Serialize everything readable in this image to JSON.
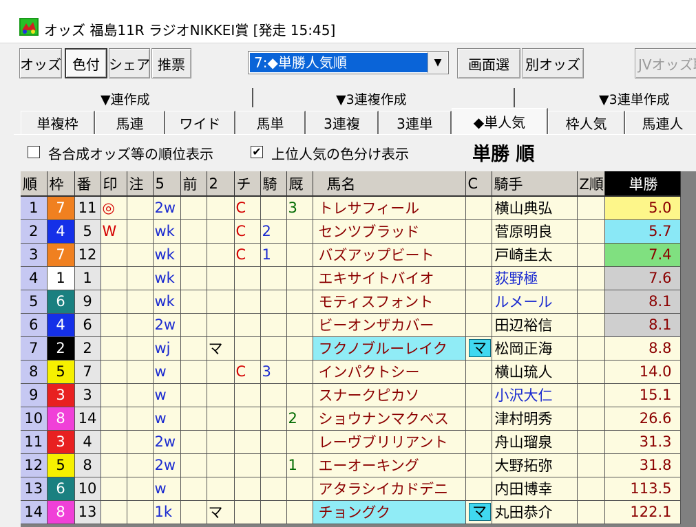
{
  "window": {
    "title": "オッズ 福島11R ラジオNIKKEI賞 [発走 15:45]"
  },
  "toolbar": {
    "buttons": [
      "オッズ",
      "色付",
      "シェア",
      "推票"
    ],
    "combo_value": "7:◆単勝人気順",
    "screen_select": "画面選",
    "other_odds": "別オッズ",
    "jv_odds": "JVオッズ取"
  },
  "groups": [
    "▼連作成",
    "▼3連複作成",
    "▼3連単作成"
  ],
  "tabs": [
    "単複枠",
    "馬連",
    "ワイド",
    "馬単",
    "3連複",
    "3連単",
    "◆単人気",
    "枠人気",
    "馬連人"
  ],
  "options": {
    "rank_display": "各合成オッズ等の順位表示",
    "rank_display_checked": false,
    "color_display": "上位人気の色分け表示",
    "color_display_checked": true,
    "sort_title": "単勝 順"
  },
  "columns": [
    "順",
    "枠",
    "番",
    "印",
    "注",
    "5",
    "前",
    "2",
    "チ",
    "騎",
    "厩",
    "馬名",
    "C",
    "騎手",
    "Z順",
    "単勝"
  ],
  "colors": {
    "waku": {
      "1": [
        "#ffffff",
        "#000000"
      ],
      "2": [
        "#000000",
        "#ffffff"
      ],
      "3": [
        "#e82020",
        "#ffffff"
      ],
      "4": [
        "#1530e8",
        "#ffffff"
      ],
      "5": [
        "#f6f000",
        "#000000"
      ],
      "6": [
        "#1a8080",
        "#ffffff"
      ],
      "7": [
        "#f08020",
        "#ffffff"
      ],
      "8": [
        "#f040d8",
        "#ffffff"
      ]
    },
    "odds_highlight": {
      "1": "#fdf68a",
      "2": "#8ae8f6",
      "3": "#80e080",
      "others_top": "#cfcfcf"
    }
  },
  "rows": [
    {
      "rank": "1",
      "waku": "7",
      "num": "11",
      "mark": "◎",
      "note": "",
      "c5": "2w",
      "mae": "",
      "c2": "",
      "chi": "C",
      "ki": "",
      "kyu": "3",
      "name": "トレサフィール",
      "c": "",
      "jockey": "横山典弘",
      "jblue": false,
      "z": "",
      "odds": "5.0"
    },
    {
      "rank": "2",
      "waku": "4",
      "num": "5",
      "mark": "W",
      "note": "",
      "c5": "wk",
      "mae": "",
      "c2": "",
      "chi": "C",
      "ki": "2",
      "kyu": "",
      "name": "センツブラッド",
      "c": "",
      "jockey": "菅原明良",
      "jblue": false,
      "z": "",
      "odds": "5.7"
    },
    {
      "rank": "3",
      "waku": "7",
      "num": "12",
      "mark": "",
      "note": "",
      "c5": "wk",
      "mae": "",
      "c2": "",
      "chi": "C",
      "ki": "1",
      "kyu": "",
      "name": "バズアップビート",
      "c": "",
      "jockey": "戸崎圭太",
      "jblue": false,
      "z": "",
      "odds": "7.4"
    },
    {
      "rank": "4",
      "waku": "1",
      "num": "1",
      "mark": "",
      "note": "",
      "c5": "wk",
      "mae": "",
      "c2": "",
      "chi": "",
      "ki": "",
      "kyu": "",
      "name": "エキサイトバイオ",
      "c": "",
      "jockey": "荻野極",
      "jblue": true,
      "z": "",
      "odds": "7.6"
    },
    {
      "rank": "5",
      "waku": "6",
      "num": "9",
      "mark": "",
      "note": "",
      "c5": "wk",
      "mae": "",
      "c2": "",
      "chi": "",
      "ki": "",
      "kyu": "",
      "name": "モティスフォント",
      "c": "",
      "jockey": "ルメール",
      "jblue": true,
      "z": "",
      "odds": "8.1"
    },
    {
      "rank": "6",
      "waku": "4",
      "num": "6",
      "mark": "",
      "note": "",
      "c5": "2w",
      "mae": "",
      "c2": "",
      "chi": "",
      "ki": "",
      "kyu": "",
      "name": "ビーオンザカバー",
      "c": "",
      "jockey": "田辺裕信",
      "jblue": false,
      "z": "",
      "odds": "8.1"
    },
    {
      "rank": "7",
      "waku": "2",
      "num": "2",
      "mark": "",
      "note": "",
      "c5": "wj",
      "mae": "",
      "c2": "マ",
      "chi": "",
      "ki": "",
      "kyu": "",
      "name": "フクノブルーレイク",
      "c": "マ",
      "jockey": "松岡正海",
      "jblue": false,
      "z": "",
      "odds": "8.8"
    },
    {
      "rank": "8",
      "waku": "5",
      "num": "7",
      "mark": "",
      "note": "",
      "c5": "w",
      "mae": "",
      "c2": "",
      "chi": "C",
      "ki": "3",
      "kyu": "",
      "name": "インパクトシー",
      "c": "",
      "jockey": "横山琉人",
      "jblue": false,
      "z": "",
      "odds": "14.0"
    },
    {
      "rank": "9",
      "waku": "3",
      "num": "3",
      "mark": "",
      "note": "",
      "c5": "w",
      "mae": "",
      "c2": "",
      "chi": "",
      "ki": "",
      "kyu": "",
      "name": "スナークピカソ",
      "c": "",
      "jockey": "小沢大仁",
      "jblue": true,
      "z": "",
      "odds": "15.1"
    },
    {
      "rank": "10",
      "waku": "8",
      "num": "14",
      "mark": "",
      "note": "",
      "c5": "w",
      "mae": "",
      "c2": "",
      "chi": "",
      "ki": "",
      "kyu": "2",
      "name": "ショウナンマクベス",
      "c": "",
      "jockey": "津村明秀",
      "jblue": false,
      "z": "",
      "odds": "26.6"
    },
    {
      "rank": "11",
      "waku": "3",
      "num": "4",
      "mark": "",
      "note": "",
      "c5": "2w",
      "mae": "",
      "c2": "",
      "chi": "",
      "ki": "",
      "kyu": "",
      "name": "レーヴブリリアント",
      "c": "",
      "jockey": "舟山瑠泉",
      "jblue": false,
      "z": "",
      "odds": "31.3"
    },
    {
      "rank": "12",
      "waku": "5",
      "num": "8",
      "mark": "",
      "note": "",
      "c5": "2w",
      "mae": "",
      "c2": "",
      "chi": "",
      "ki": "",
      "kyu": "1",
      "name": "エーオーキング",
      "c": "",
      "jockey": "大野拓弥",
      "jblue": false,
      "z": "",
      "odds": "31.8"
    },
    {
      "rank": "13",
      "waku": "6",
      "num": "10",
      "mark": "",
      "note": "",
      "c5": "w",
      "mae": "",
      "c2": "",
      "chi": "",
      "ki": "",
      "kyu": "",
      "name": "アタラシイカドデニ",
      "c": "",
      "jockey": "内田博幸",
      "jblue": false,
      "z": "",
      "odds": "113.5"
    },
    {
      "rank": "14",
      "waku": "8",
      "num": "13",
      "mark": "",
      "note": "",
      "c5": "1k",
      "mae": "",
      "c2": "マ",
      "chi": "",
      "ki": "",
      "kyu": "",
      "name": "チョングク",
      "c": "マ",
      "jockey": "丸田恭介",
      "jblue": false,
      "z": "",
      "odds": "122.1"
    }
  ]
}
